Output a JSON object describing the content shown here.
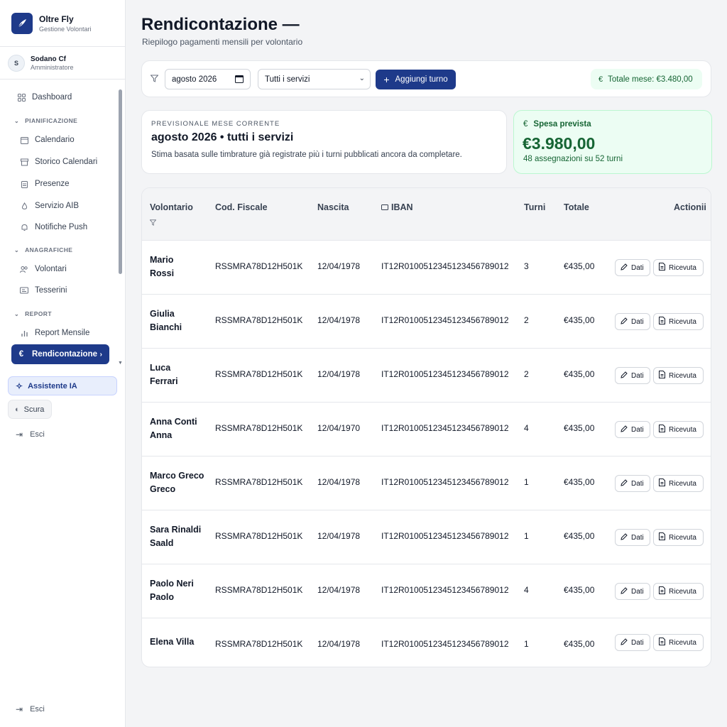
{
  "sidebar": {
    "brand_name": "Oltre Fly",
    "brand_sub": "Gestione Volontari",
    "user_initial": "S",
    "user_name": "Sodano Cf",
    "user_role": "Amministratore",
    "dashboard": "Dashboard",
    "section_plan": "PIANIFICAZIONE",
    "calendario": "Calendario",
    "storico": "Storico Calendari",
    "presenze": "Presenze",
    "servizio": "Servizio AIB",
    "notifiche": "Notifiche Push",
    "section_anag": "ANAGRAFICHE",
    "volontari": "Volontari",
    "tesserini": "Tesserini",
    "section_report": "REPORT",
    "report_mensile": "Report Mensile",
    "rendicontazione": "Rendicontazione",
    "assistente": "Assistente IA",
    "scura": "Scura",
    "esci": "Esci",
    "esci_bottom": "Esci"
  },
  "page": {
    "title": "Rendicontazione —",
    "subtitle": "Riepilogo pagamenti mensili per volontario"
  },
  "toolbar": {
    "month_value": "agosto 2026",
    "service_value": "Tutti i servizi",
    "add_label": "Aggiungi turno",
    "total_label": "Totale mese: €3.480,00"
  },
  "forecast": {
    "kicker": "PREVISIONALE MESE CORRENTE",
    "heading": "agosto 2026 • tutti i servizi",
    "description": "Stima basata sulle timbrature già registrate più i turni pubblicati ancora da completare."
  },
  "spend": {
    "label": "Spesa prevista",
    "value": "€3.980,00",
    "sub": "48 assegnazioni su 52 turni"
  },
  "table": {
    "headers": {
      "volontario": "Volontario",
      "cf": "Cod. Fiscale",
      "nascita": "Nascita",
      "iban": "IBAN",
      "turni": "Turni",
      "totale": "Totale",
      "azioni": "Actionii"
    },
    "action_dati": "Dati",
    "action_ricevuta": "Ricevuta",
    "rows": [
      {
        "name1": "Mario",
        "name2": "Rossi",
        "cf": "RSSMRA78D12H501K",
        "dob": "12/04/1978",
        "iban": "IT12R0100512345123456789012",
        "turni": "3",
        "totale": "€435,00"
      },
      {
        "name1": "Giulia",
        "name2": "Bianchi",
        "cf": "RSSMRA78D12H501K",
        "dob": "12/04/1978",
        "iban": "IT12R0100512345123456789012",
        "turni": "2",
        "totale": "€435,00"
      },
      {
        "name1": "Luca",
        "name2": "Ferrari",
        "cf": "RSSMRA78D12H501K",
        "dob": "12/04/1978",
        "iban": "IT12R0100512345123456789012",
        "turni": "2",
        "totale": "€435,00"
      },
      {
        "name1": "Anna Conti",
        "name2": "Anna",
        "cf": "RSSMRA78D12H501K",
        "dob": "12/04/1970",
        "iban": "IT12R0100512345123456789012",
        "turni": "4",
        "totale": "€435,00"
      },
      {
        "name1": "Marco Greco",
        "name2": "Greco",
        "cf": "RSSMRA78D12H501K",
        "dob": "12/04/1978",
        "iban": "IT12R0100512345123456789012",
        "turni": "1",
        "totale": "€435,00"
      },
      {
        "name1": "Sara Rinaldi",
        "name2": "Saald",
        "cf": "RSSMRA78D12H501K",
        "dob": "12/04/1978",
        "iban": "IT12R0100512345123456789012",
        "turni": "1",
        "totale": "€435,00"
      },
      {
        "name1": "Paolo Neri",
        "name2": "Paolo",
        "cf": "RSSMRA78D12H501K",
        "dob": "12/04/1978",
        "iban": "IT12R0100512345123456789012",
        "turni": "4",
        "totale": "€435,00"
      },
      {
        "name1": "Elena Villa",
        "name2": "",
        "cf": "RSSMRA78D12H501K",
        "dob": "12/04/1978",
        "iban": "IT12R0100512345123456789012",
        "turni": "1",
        "totale": "€435,00"
      }
    ]
  },
  "colors": {
    "brand": "#1e3a8a",
    "success_bg": "#ecfdf3",
    "success_text": "#166534"
  }
}
